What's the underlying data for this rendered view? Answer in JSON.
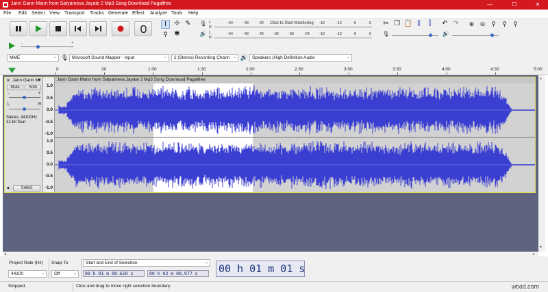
{
  "window": {
    "title": "Jann Gann Mann from Satyameva Jayate 2 Mp3 Song Download Pagalfree",
    "minimize_glyph": "—",
    "maximize_glyph": "☐",
    "close_glyph": "✕"
  },
  "menu": [
    "File",
    "Edit",
    "Select",
    "View",
    "Transport",
    "Tracks",
    "Generate",
    "Effect",
    "Analyze",
    "Tools",
    "Help"
  ],
  "transport": {
    "icons": [
      "pause-icon",
      "play-icon",
      "stop-icon",
      "skip-to-start-icon",
      "skip-to-end-icon",
      "record-icon",
      "loop-icon"
    ]
  },
  "tools": {
    "icons": [
      "selection-tool-icon",
      "envelope-tool-icon",
      "draw-tool-icon",
      "zoom-tool-icon",
      "multi-tool-icon"
    ]
  },
  "meters": {
    "record_hint": "Click to Start Monitoring",
    "scale": [
      "-54",
      "-48",
      "-42",
      "-36",
      "-30",
      "-24",
      "-18",
      "-12",
      "-6",
      "0"
    ],
    "record_scale": [
      "-54",
      "-48",
      "-42",
      "",
      "",
      "",
      "-18",
      "-12",
      "-6",
      "0"
    ],
    "lr_top": [
      "L",
      "R"
    ],
    "lr_bottom": [
      "L",
      "R"
    ]
  },
  "edit_tools": {
    "icons": [
      "cut-icon",
      "copy-icon",
      "paste-icon",
      "trim-icon",
      "silence-icon",
      "undo-icon",
      "redo-icon",
      "zoom-in-icon",
      "zoom-out-icon",
      "fit-selection-icon",
      "fit-project-icon",
      "zoom-toggle-icon"
    ]
  },
  "device": {
    "host": "MME",
    "input": "Microsoft Sound Mapper - Input",
    "channels": "2 (Stereo) Recording Chann",
    "output": "Speakers (High Definition Audio"
  },
  "play_at_speed": {
    "minus": "-",
    "plus": "+"
  },
  "ruler": {
    "labels": [
      "0",
      "30",
      "1:00",
      "1:30",
      "2:00",
      "2:30",
      "3:00",
      "3:30",
      "4:00",
      "4:30",
      "5:00"
    ]
  },
  "track": {
    "name": "Jann Gann M",
    "clip_name": "Jann Gann Mann from Satyameva Jayate 2 Mp3 Song Download Pagalfree",
    "mute": "Mute",
    "solo": "Solo",
    "gain_minus": "-",
    "gain_plus": "+",
    "pan_left": "L",
    "pan_right": "R",
    "info_line1": "Stereo, 44100Hz",
    "info_line2": "32-bit float",
    "select": "Select",
    "scale": [
      "1.0",
      "0.5",
      "0.0",
      "-0.5",
      "-1.0"
    ],
    "scale_lower": [
      "1.0",
      "0.5",
      "0.0",
      "-0.5",
      "-1.0"
    ]
  },
  "selection_toolbar": {
    "rate_label": "Project Rate (Hz)",
    "rate_value": "44100",
    "snap_label": "Snap-To",
    "snap_value": "Off",
    "mode": "Start and End of Selection",
    "start_time": "00 h 01 m 00.610 s",
    "end_time": "00 h 02 m 00.977 s",
    "audio_position": "00 h 01 m 01 s"
  },
  "status": {
    "state": "Stopped.",
    "hint": "Click and drag to move right selection boundary.",
    "watermark": "wtxid.com"
  },
  "colors": {
    "titlebar": "#d4181f",
    "waveform": "#3b3fd1",
    "waveform_selected": "#5a5fe0",
    "track_bg": "#d2d2d2",
    "selected_bg": "#ffffff",
    "empty_area": "#5e637f"
  }
}
